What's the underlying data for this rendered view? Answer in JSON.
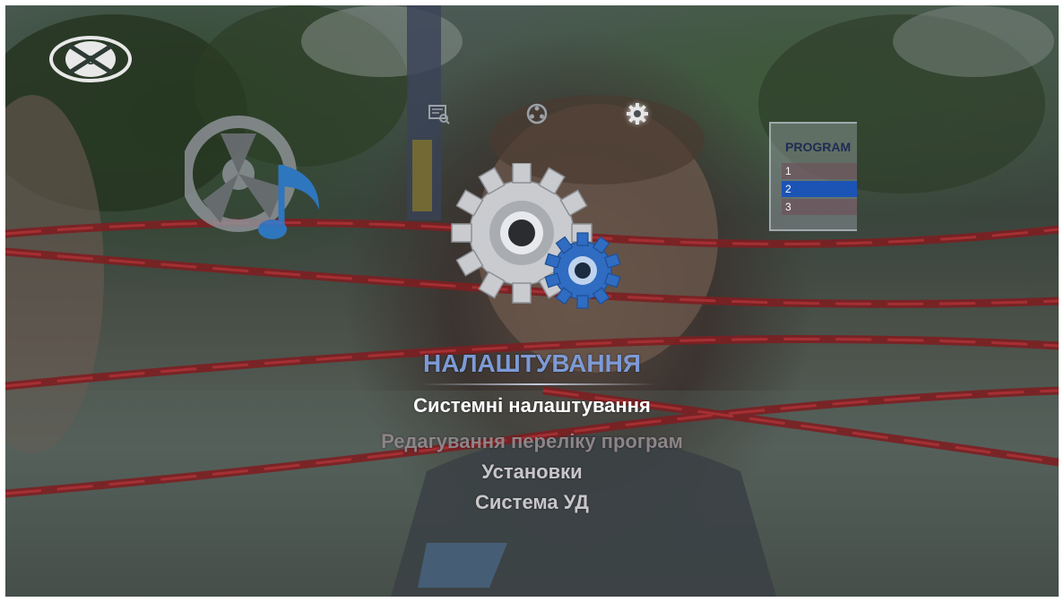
{
  "logo": {
    "icon": "ex-logo-icon"
  },
  "top_menu": [
    {
      "icon": "media-browser-icon",
      "active": false
    },
    {
      "icon": "film-reel-icon",
      "active": false
    },
    {
      "icon": "gear-icon",
      "active": true
    }
  ],
  "program_preview": {
    "title": "PROGRAM",
    "rows": [
      "1",
      "2",
      "3"
    ],
    "selected_index": 1
  },
  "menu": {
    "title": "НАЛАШТУВАННЯ",
    "items": [
      {
        "label": "Системні налаштування",
        "state": "selected"
      },
      {
        "label": "Редагування переліку програм",
        "state": "dim"
      },
      {
        "label": "Установки",
        "state": "normal"
      },
      {
        "label": "Система УД",
        "state": "normal"
      }
    ]
  },
  "colors": {
    "menu_title": "#7d9ad6",
    "selected_item": "#ffffff",
    "normal_item": "#c9c6c9",
    "highlight_row": "#1b54b4",
    "gear_blue": "#2f6cc2"
  }
}
